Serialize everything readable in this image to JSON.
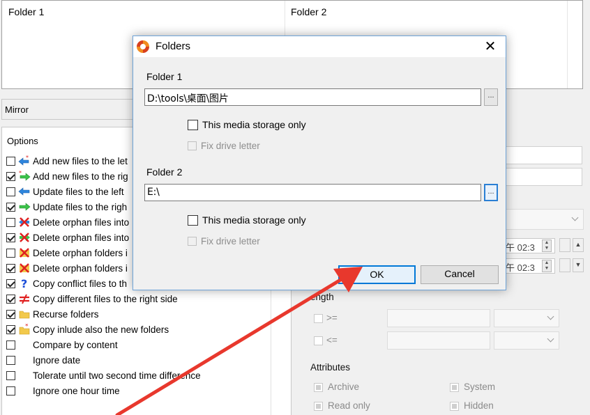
{
  "folders_list": {
    "col1_header": "Folder 1",
    "col2_header": "Folder 2"
  },
  "profile_bar": {
    "label": "Mirror"
  },
  "options": {
    "title": "Options",
    "items": [
      {
        "label": "Add new files to the let",
        "checked": false,
        "icon": "add-left-icon"
      },
      {
        "label": "Add new files to the rig",
        "checked": true,
        "icon": "add-right-icon"
      },
      {
        "label": "Update files to the left",
        "checked": false,
        "icon": "update-left-icon"
      },
      {
        "label": "Update files to the righ",
        "checked": true,
        "icon": "update-right-icon"
      },
      {
        "label": "Delete orphan files into",
        "checked": false,
        "icon": "delete-files-left-icon"
      },
      {
        "label": "Delete orphan files into",
        "checked": true,
        "icon": "delete-files-right-icon"
      },
      {
        "label": "Delete orphan folders i",
        "checked": false,
        "icon": "delete-folders-left-icon"
      },
      {
        "label": "Delete orphan folders i",
        "checked": true,
        "icon": "delete-folders-right-icon"
      },
      {
        "label": "Copy conflict files to th",
        "checked": true,
        "icon": "question-icon"
      },
      {
        "label": "Copy different files to the right side",
        "checked": true,
        "icon": "not-equal-icon"
      },
      {
        "label": "Recurse folders",
        "checked": true,
        "icon": "folder-icon"
      },
      {
        "label": "Copy inlude also the new folders",
        "checked": true,
        "icon": "new-folder-icon"
      },
      {
        "label": "Compare by content",
        "checked": false,
        "icon": ""
      },
      {
        "label": "Ignore date",
        "checked": false,
        "icon": ""
      },
      {
        "label": "Tolerate until two second time difference",
        "checked": false,
        "icon": ""
      },
      {
        "label": "Ignore one hour time",
        "checked": false,
        "icon": ""
      }
    ]
  },
  "right_panel": {
    "time1": "午 02:3",
    "time2": "午 02:3",
    "length_label": "ength",
    "gte_label": ">=",
    "lte_label": "<=",
    "attributes_label": "Attributes",
    "attr_archive": "Archive",
    "attr_system": "System",
    "attr_readonly": "Read only",
    "attr_hidden": "Hidden"
  },
  "dialog": {
    "title": "Folders",
    "close_glyph": "✕",
    "folder1_label": "Folder 1",
    "folder1_path": "D:\\tools\\桌面\\图片",
    "browse_glyph": "...",
    "media_only_label": "This media storage only",
    "fix_drive_label": "Fix drive letter",
    "folder2_label": "Folder 2",
    "folder2_path": "E:\\",
    "ok_label": "OK",
    "cancel_label": "Cancel"
  },
  "colors": {
    "accent": "#0078d7",
    "annotation_arrow": "#e8382d"
  }
}
